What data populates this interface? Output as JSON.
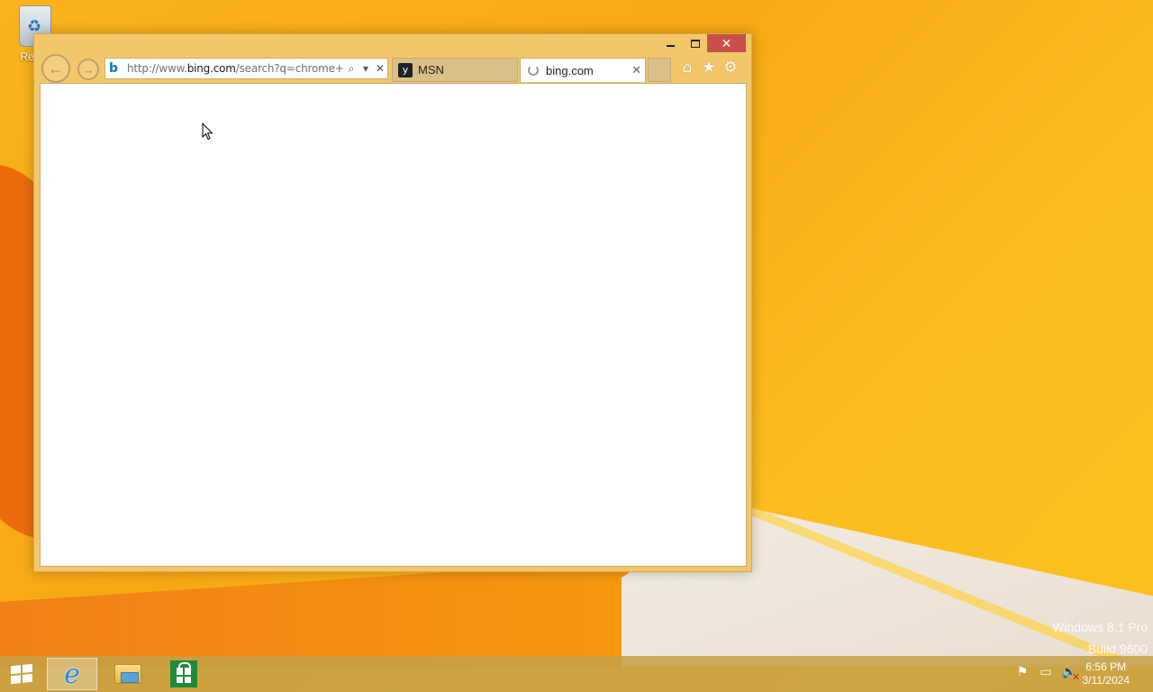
{
  "desktop": {
    "recycle_bin_label": "Recyc"
  },
  "browser": {
    "address_url": "http://www.bing.com/search?q=chrome+dc",
    "address_url_prefix": "http://www.",
    "address_url_domain": "bing.com",
    "address_url_suffix": "/search?q=chrome+dc",
    "tabs": [
      {
        "label": "MSN",
        "icon": "msn-icon",
        "active": false
      },
      {
        "label": "bing.com",
        "icon": "loading-icon",
        "active": true
      }
    ],
    "icons": {
      "home": "home-icon",
      "favorites": "star-icon",
      "tools": "gear-icon"
    }
  },
  "watermark": {
    "line1": "Windows 8.1 Pro",
    "line2": "Build 9600"
  },
  "taskbar": {
    "pinned": [
      "internet-explorer-icon",
      "file-explorer-icon",
      "store-icon"
    ],
    "clock_time": "6:56 PM",
    "clock_date": "3/11/2024"
  },
  "colors": {
    "window_frame": "#f2c76a",
    "close_button": "#c7504b",
    "desktop_bg": "#f9b31b"
  }
}
